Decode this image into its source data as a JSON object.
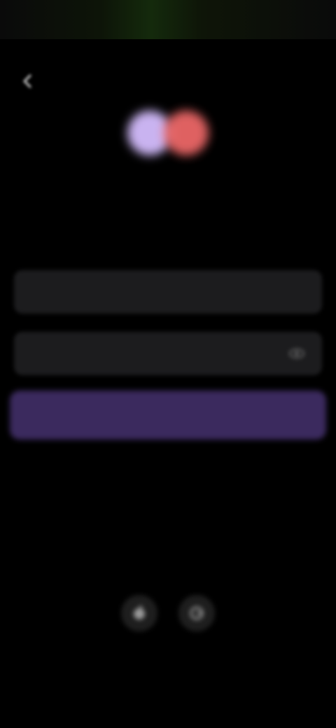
{
  "status_bar": {
    "time": "",
    "indicators": ""
  },
  "header": {
    "back_icon": "chevron-left-icon",
    "title": "",
    "subtitle": ""
  },
  "form": {
    "email_placeholder": "",
    "email_value": "",
    "password_placeholder": "",
    "password_value": "",
    "password_toggle_icon": "eye-icon",
    "submit_label": ""
  },
  "forgot_password_label": "",
  "alternative": {
    "label": "",
    "providers": [
      {
        "icon": "apple-icon"
      },
      {
        "icon": "google-icon"
      }
    ]
  },
  "footer_text": "",
  "colors": {
    "background": "#000000",
    "field_background": "#1c1c1e",
    "primary_button": "#3b2a5e",
    "logo_left": "#c9b3f0",
    "logo_right": "#f26a6a"
  }
}
